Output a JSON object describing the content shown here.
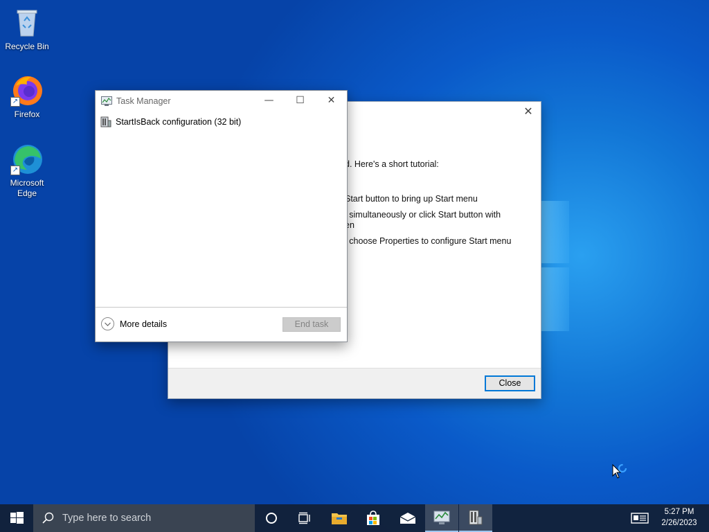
{
  "desktop": {
    "icons": [
      {
        "label": "Recycle Bin",
        "icon": "recycle-bin-icon"
      },
      {
        "label": "Firefox",
        "icon": "firefox-icon"
      },
      {
        "label": "Microsoft Edge",
        "icon": "edge-icon"
      }
    ]
  },
  "back_dialog": {
    "lines": [
      "d. Here's a short tutorial:",
      "Start button to bring up Start menu",
      "l simultaneously or click Start button with",
      "en",
      "l choose Properties to configure Start menu"
    ],
    "close_button_label": "Close"
  },
  "task_manager": {
    "title": "Task Manager",
    "processes": [
      {
        "name": "StartIsBack configuration (32 bit)",
        "icon": "startisback-icon"
      }
    ],
    "more_details_label": "More details",
    "end_task_label": "End task"
  },
  "taskbar": {
    "search_placeholder": "Type here to search",
    "time": "5:27 PM",
    "date": "2/26/2023"
  },
  "colors": {
    "accent": "#0078d7",
    "taskbar": "#122034"
  }
}
